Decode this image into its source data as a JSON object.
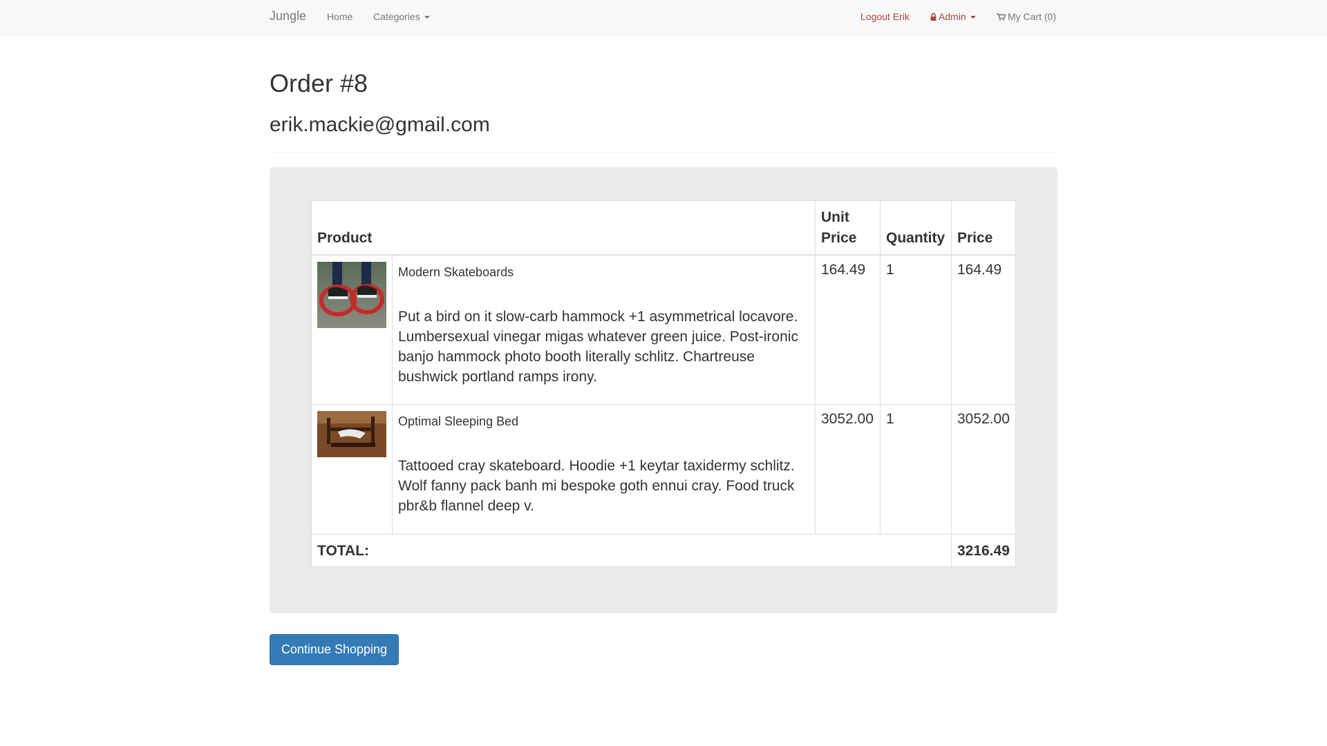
{
  "nav": {
    "brand": "Jungle",
    "home": "Home",
    "categories": "Categories",
    "logout": "Logout Erik",
    "admin": "Admin",
    "cart": "My Cart (0)"
  },
  "order": {
    "title": "Order #8",
    "email": "erik.mackie@gmail.com"
  },
  "table": {
    "headers": {
      "product": "Product",
      "unit_price": "Unit Price",
      "quantity": "Quantity",
      "price": "Price"
    },
    "rows": [
      {
        "name": "Modern Skateboards",
        "description": "Put a bird on it slow-carb hammock +1 asymmetrical locavore. Lumbersexual vinegar migas whatever green juice. Post-ironic banjo hammock photo booth literally schlitz. Chartreuse bushwick portland ramps irony.",
        "unit_price": "164.49",
        "quantity": "1",
        "price": "164.49"
      },
      {
        "name": "Optimal Sleeping Bed",
        "description": "Tattooed cray skateboard. Hoodie +1 keytar taxidermy schlitz. Wolf fanny pack banh mi bespoke goth ennui cray. Food truck pbr&b flannel deep v.",
        "unit_price": "3052.00",
        "quantity": "1",
        "price": "3052.00"
      }
    ],
    "total_label": "TOTAL:",
    "total_value": "3216.49"
  },
  "continue_label": "Continue Shopping",
  "colors": {
    "primary": "#337ab7",
    "danger": "#a94442",
    "navbar": "#f8f8f8"
  },
  "icons": {
    "admin": "lock-icon",
    "cart": "cart-icon"
  }
}
